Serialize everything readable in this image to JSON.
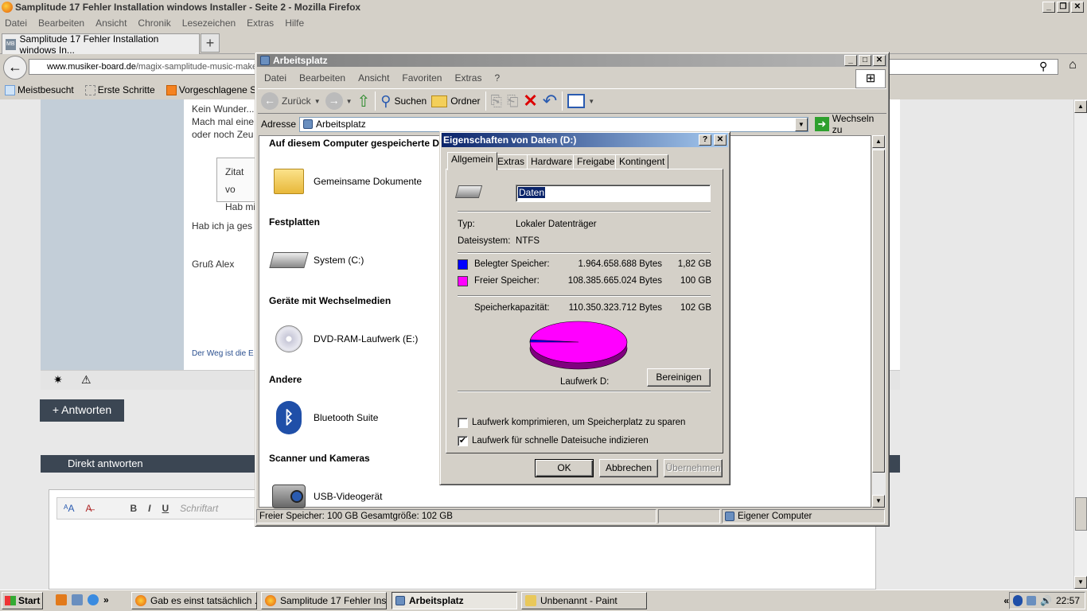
{
  "firefox": {
    "title": "Samplitude 17 Fehler Installation windows Installer - Seite 2 - Mozilla Firefox",
    "menu": [
      "Datei",
      "Bearbeiten",
      "Ansicht",
      "Chronik",
      "Lesezeichen",
      "Extras",
      "Hilfe"
    ],
    "tab_title": "Samplitude 17 Fehler Installation windows In...",
    "tab_favicon": "MB",
    "url_domain": "www.musiker-board.de",
    "url_path": "/magix-samplitude-music-maker",
    "bookmarks": [
      "Meistbesucht",
      "Erste Schritte",
      "Vorgeschlagene Sites"
    ]
  },
  "page": {
    "post_lines": [
      "Kein Wunder...",
      "Mach mal eine",
      "oder noch Zeu"
    ],
    "quote_lines": [
      "Zitat vo",
      "Hab mi"
    ],
    "after_quote": "Hab ich ja ges",
    "greeting": "Gruß Alex",
    "signature": "Der Weg ist die E",
    "answer_button": "+ Antworten",
    "direct_reply": "Direkt antworten",
    "font_placeholder": "Schriftart"
  },
  "explorer": {
    "title": "Arbeitsplatz",
    "menu": [
      "Datei",
      "Bearbeiten",
      "Ansicht",
      "Favoriten",
      "Extras",
      "?"
    ],
    "toolbar": {
      "back": "Zurück",
      "search": "Suchen",
      "folders": "Ordner"
    },
    "address_label": "Adresse",
    "address_value": "Arbeitsplatz",
    "go_label": "Wechseln zu",
    "groups": {
      "stored": "Auf diesem Computer gespeicherte Da",
      "disks": "Festplatten",
      "removable": "Geräte mit Wechselmedien",
      "other": "Andere",
      "scanners": "Scanner und Kameras"
    },
    "items": {
      "shared_docs": "Gemeinsame Dokumente",
      "system_c": "System (C:)",
      "dvd": "DVD-RAM-Laufwerk (E:)",
      "bluetooth": "Bluetooth Suite",
      "video": "USB-Videogerät"
    },
    "status_left": "Freier Speicher: 100 GB Gesamtgröße: 102 GB",
    "status_right": "Eigener Computer"
  },
  "dialog": {
    "title": "Eigenschaften von Daten (D:)",
    "tabs": [
      "Allgemein",
      "Extras",
      "Hardware",
      "Freigabe",
      "Kontingent"
    ],
    "name_value": "Daten",
    "type_label": "Typ:",
    "type_value": "Lokaler Datenträger",
    "fs_label": "Dateisystem:",
    "fs_value": "NTFS",
    "used_label": "Belegter Speicher:",
    "used_bytes": "1.964.658.688 Bytes",
    "used_gb": "1,82 GB",
    "free_label": "Freier Speicher:",
    "free_bytes": "108.385.665.024 Bytes",
    "free_gb": "100 GB",
    "cap_label": "Speicherkapazität:",
    "cap_bytes": "110.350.323.712 Bytes",
    "cap_gb": "102 GB",
    "drive_label": "Laufwerk D:",
    "cleanup": "Bereinigen",
    "compress_label": "Laufwerk komprimieren, um Speicherplatz zu sparen",
    "compress_checked": false,
    "index_label": "Laufwerk für schnelle Dateisuche indizieren",
    "index_checked": true,
    "ok": "OK",
    "cancel": "Abbrechen",
    "apply": "Übernehmen",
    "used_color": "#0000ff",
    "free_color": "#ff00ff",
    "used_fraction": 0.0178
  },
  "taskbar": {
    "start": "Start",
    "tasks": [
      "Gab es einst tatsächlich ...",
      "Samplitude 17 Fehler Ins...",
      "Arbeitsplatz",
      "Unbenannt - Paint"
    ],
    "chevron": "»",
    "tray_chevron": "«",
    "clock": "22:57"
  }
}
